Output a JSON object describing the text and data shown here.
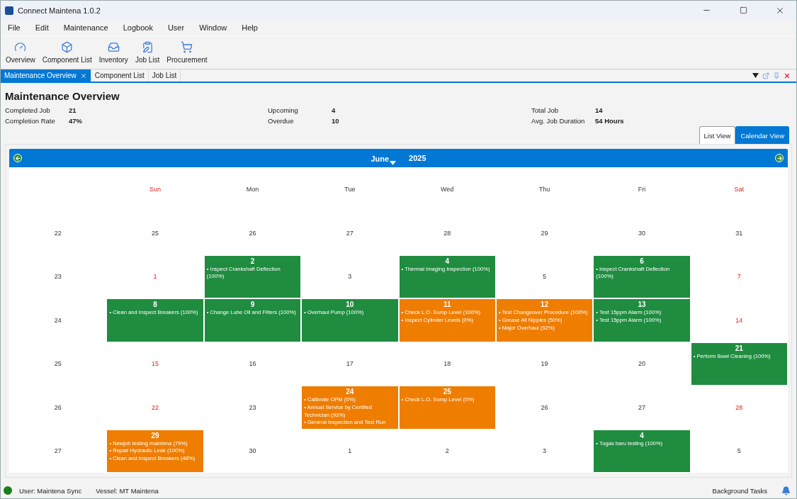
{
  "window": {
    "title": "Connect Maintena 1.0.2"
  },
  "menu": [
    "File",
    "Edit",
    "Maintenance",
    "Logbook",
    "User",
    "Window",
    "Help"
  ],
  "toolbar": [
    {
      "kind": "gauge",
      "label": "Overview"
    },
    {
      "kind": "cube",
      "label": "Component List"
    },
    {
      "kind": "tray",
      "label": "Inventory"
    },
    {
      "kind": "clipboard",
      "label": "Job List"
    },
    {
      "kind": "cart",
      "label": "Procurement"
    }
  ],
  "doc_tabs": [
    {
      "label": "Maintenance Overview",
      "selected": true,
      "closable": true
    },
    {
      "label": "Component List",
      "selected": false,
      "closable": false
    },
    {
      "label": "Job List",
      "selected": false,
      "closable": false
    }
  ],
  "page_title": "Maintenance Overview",
  "stats": [
    [
      {
        "label": "Completed Job",
        "value": "21"
      },
      {
        "label": "Completion Rate",
        "value": "47%"
      }
    ],
    [
      {
        "label": "Upcoming",
        "value": "4"
      },
      {
        "label": "Overdue",
        "value": "10"
      }
    ],
    [
      {
        "label": "Total Job",
        "value": "14"
      },
      {
        "label": "Avg. Job Duration",
        "value": "54 Hours"
      }
    ]
  ],
  "view_tabs": [
    {
      "label": "List View",
      "selected": false
    },
    {
      "label": "Calendar View",
      "selected": true
    }
  ],
  "calendar": {
    "month": "June",
    "year": "2025",
    "weekdays": [
      {
        "label": "Sun",
        "weekend": true
      },
      {
        "label": "Mon",
        "weekend": false
      },
      {
        "label": "Tue",
        "weekend": false
      },
      {
        "label": "Wed",
        "weekend": false
      },
      {
        "label": "Thu",
        "weekend": false
      },
      {
        "label": "Fri",
        "weekend": false
      },
      {
        "label": "Sat",
        "weekend": true
      }
    ],
    "weeks": [
      {
        "week": "22",
        "days": [
          {
            "kind": "plain",
            "day": "25",
            "weekend": false
          },
          {
            "kind": "plain",
            "day": "26",
            "weekend": false
          },
          {
            "kind": "plain",
            "day": "27",
            "weekend": false
          },
          {
            "kind": "plain",
            "day": "28",
            "weekend": false
          },
          {
            "kind": "plain",
            "day": "29",
            "weekend": false
          },
          {
            "kind": "plain",
            "day": "30",
            "weekend": false
          },
          {
            "kind": "plain",
            "day": "31",
            "weekend": false
          }
        ]
      },
      {
        "week": "23",
        "days": [
          {
            "kind": "plain",
            "day": "1",
            "weekend": true
          },
          {
            "kind": "event",
            "day": "2",
            "color": "#1f8c3f",
            "jobs": [
              "• Inspect Crankshaft Deflection (100%)"
            ]
          },
          {
            "kind": "plain",
            "day": "3",
            "weekend": false
          },
          {
            "kind": "event",
            "day": "4",
            "color": "#1f8c3f",
            "jobs": [
              "• Thermal Imaging Inspection (100%)"
            ]
          },
          {
            "kind": "plain",
            "day": "5",
            "weekend": false
          },
          {
            "kind": "event",
            "day": "6",
            "color": "#1f8c3f",
            "jobs": [
              "• Inspect Crankshaft Deflection (100%)"
            ]
          },
          {
            "kind": "plain",
            "day": "7",
            "weekend": true
          }
        ]
      },
      {
        "week": "24",
        "days": [
          {
            "kind": "event",
            "day": "8",
            "color": "#1f8c3f",
            "jobs": [
              "• Clean and Inspect Breakers (100%)"
            ]
          },
          {
            "kind": "event",
            "day": "9",
            "color": "#1f8c3f",
            "jobs": [
              "• Change Lube Oil and Filters (100%)"
            ]
          },
          {
            "kind": "event",
            "day": "10",
            "color": "#1f8c3f",
            "jobs": [
              "• Overhaul Pump (100%)"
            ]
          },
          {
            "kind": "event",
            "day": "11",
            "color": "#ee7d00",
            "jobs": [
              "• Check L.O. Sump Level (100%)",
              "• Inspect Cylinder Levels (0%)"
            ]
          },
          {
            "kind": "event",
            "day": "12",
            "color": "#ee7d00",
            "jobs": [
              "• Test Changeover Procedure (100%)",
              "• Grease All Nipples (50%)",
              "• Major Overhaul (52%)"
            ]
          },
          {
            "kind": "event",
            "day": "13",
            "color": "#1f8c3f",
            "jobs": [
              "• Test 15ppm Alarm (100%)",
              "• Test 15ppm Alarm (100%)"
            ]
          },
          {
            "kind": "plain",
            "day": "14",
            "weekend": true
          }
        ]
      },
      {
        "week": "25",
        "days": [
          {
            "kind": "plain",
            "day": "15",
            "weekend": true
          },
          {
            "kind": "plain",
            "day": "16",
            "weekend": false
          },
          {
            "kind": "plain",
            "day": "17",
            "weekend": false
          },
          {
            "kind": "plain",
            "day": "18",
            "weekend": false
          },
          {
            "kind": "plain",
            "day": "19",
            "weekend": false
          },
          {
            "kind": "plain",
            "day": "20",
            "weekend": false
          },
          {
            "kind": "event",
            "day": "21",
            "color": "#1f8c3f",
            "jobs": [
              "• Perform Bowl Cleaning (100%)"
            ]
          }
        ]
      },
      {
        "week": "26",
        "days": [
          {
            "kind": "plain",
            "day": "22",
            "weekend": true
          },
          {
            "kind": "plain",
            "day": "23",
            "weekend": false
          },
          {
            "kind": "event",
            "day": "24",
            "color": "#ee7d00",
            "jobs": [
              "• Calibrate OPM (0%)",
              "• Annual Service by Certified Technician (93%)",
              "• General Inspection and Test Run"
            ]
          },
          {
            "kind": "event",
            "day": "25",
            "color": "#ee7d00",
            "jobs": [
              "• Check L.O. Sump Level (0%)"
            ]
          },
          {
            "kind": "plain",
            "day": "26",
            "weekend": false
          },
          {
            "kind": "plain",
            "day": "27",
            "weekend": false
          },
          {
            "kind": "plain",
            "day": "28",
            "weekend": true
          }
        ]
      },
      {
        "week": "27",
        "days": [
          {
            "kind": "event",
            "day": "29",
            "color": "#ee7d00",
            "jobs": [
              "• Newjob testing maintena (79%)",
              "• Repair Hydraulic Leak (100%)",
              "• Clean and Inspect Breakers (48%)"
            ]
          },
          {
            "kind": "plain",
            "day": "30",
            "weekend": false
          },
          {
            "kind": "plain",
            "day": "1",
            "weekend": false
          },
          {
            "kind": "plain",
            "day": "2",
            "weekend": false
          },
          {
            "kind": "plain",
            "day": "3",
            "weekend": false
          },
          {
            "kind": "event",
            "day": "4",
            "color": "#1f8c3f",
            "jobs": [
              "• Tugas baru testing (100%)"
            ]
          },
          {
            "kind": "plain",
            "day": "5",
            "weekend": false
          }
        ]
      }
    ]
  },
  "status_bar": {
    "connected": true,
    "user": "User: Maintena Sync",
    "vessel": "Vessel: MT Maintena",
    "tasks": "Background Tasks"
  }
}
